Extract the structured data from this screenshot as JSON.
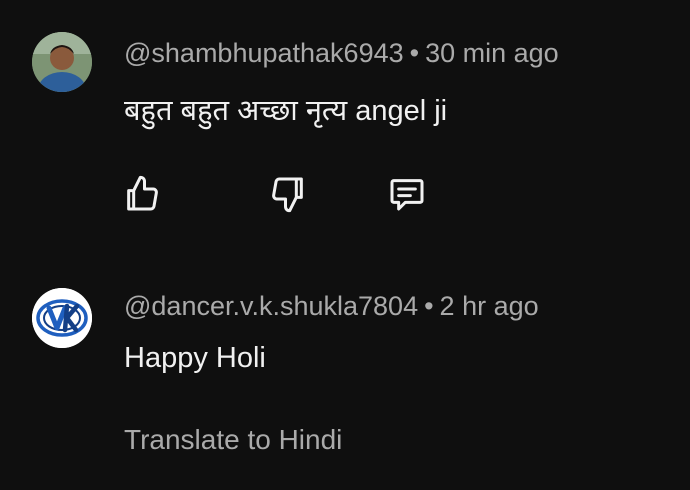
{
  "comments": [
    {
      "handle": "@shambhupathak6943",
      "separator": "•",
      "time": "30 min ago",
      "text": "बहुत बहुत अच्छा नृत्य angel ji",
      "avatar_icon": "user-photo-avatar"
    },
    {
      "handle": "@dancer.v.k.shukla7804",
      "separator": "•",
      "time": "2 hr ago",
      "text": "Happy Holi",
      "avatar_icon": "vk-logo-avatar",
      "translate_label": "Translate to Hindi"
    }
  ],
  "actions": {
    "like_icon": "thumbs-up-icon",
    "dislike_icon": "thumbs-down-icon",
    "reply_icon": "reply-comment-icon"
  },
  "colors": {
    "background": "#0f0f0f",
    "primary_text": "#f1f1f1",
    "secondary_text": "#aaaaaa",
    "vk_logo": "#1f5fbf"
  }
}
